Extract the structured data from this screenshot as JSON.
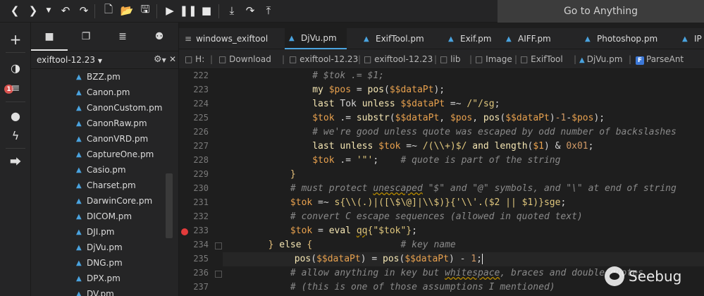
{
  "toolbar": {
    "goto_label": "Go to Anything",
    "icons": [
      "chevron-left-icon",
      "chevron-right-icon",
      "dropdown-icon",
      "undo-icon",
      "redo-icon",
      "new-file-icon",
      "open-folder-icon",
      "save-icon",
      "play-icon",
      "pause-icon",
      "stop-icon",
      "step-into-icon",
      "step-over-icon",
      "step-out-icon"
    ]
  },
  "activity": {
    "badge_count": "1"
  },
  "panel": {
    "project_name": "exiftool-12.23",
    "files": [
      "BZZ.pm",
      "Canon.pm",
      "CanonCustom.pm",
      "CanonRaw.pm",
      "CanonVRD.pm",
      "CaptureOne.pm",
      "Casio.pm",
      "Charset.pm",
      "DarwinCore.pm",
      "DICOM.pm",
      "DJI.pm",
      "DjVu.pm",
      "DNG.pm",
      "DPX.pm",
      "DV.pm"
    ]
  },
  "tabs": [
    {
      "label": "windows_exiftool",
      "active": false
    },
    {
      "label": "DjVu.pm",
      "active": true
    },
    {
      "label": "ExifTool.pm",
      "active": false
    },
    {
      "label": "Exif.pm",
      "active": false
    },
    {
      "label": "AIFF.pm",
      "active": false
    },
    {
      "label": "Photoshop.pm",
      "active": false
    },
    {
      "label": "IP",
      "active": false
    }
  ],
  "breadcrumb": [
    "H:",
    "Download",
    "exiftool-12.23",
    "exiftool-12.23",
    "lib",
    "Image",
    "ExifTool",
    "DjVu.pm",
    "ParseAnt"
  ],
  "code": {
    "line_numbers": [
      "222",
      "223",
      "224",
      "225",
      "226",
      "227",
      "228",
      "229",
      "230",
      "231",
      "232",
      "233",
      "234",
      "235",
      "236",
      "237"
    ],
    "breakpoint_line": "233",
    "current_line": "235"
  },
  "watermark": {
    "text": "Seebug"
  },
  "colors": {
    "accent": "#4aa3df",
    "breakpoint": "#e23b3b",
    "background": "#1e1e1e",
    "panel": "#252526"
  }
}
